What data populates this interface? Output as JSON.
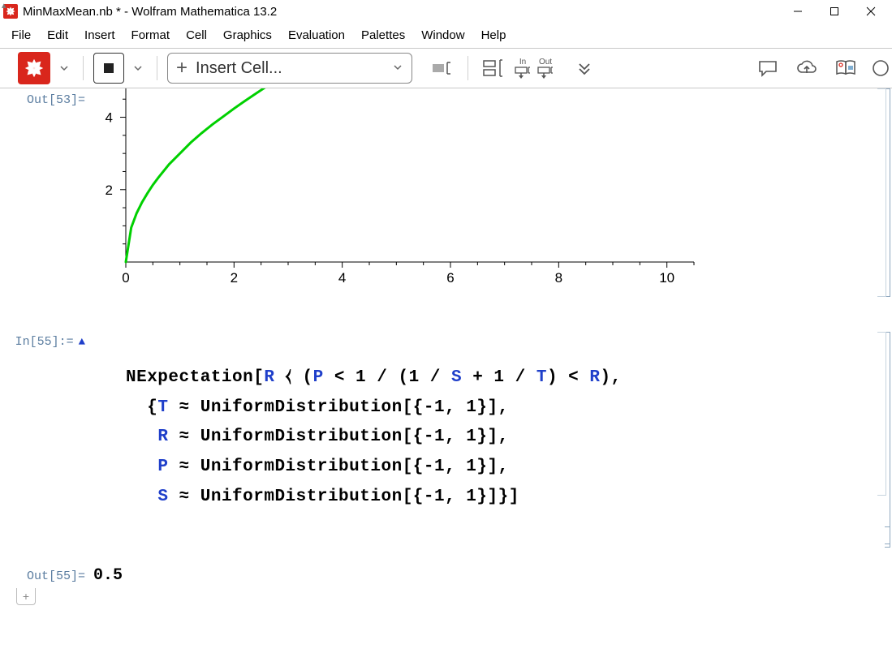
{
  "window": {
    "title": "MinMaxMean.nb * - Wolfram Mathematica 13.2"
  },
  "menus": [
    "File",
    "Edit",
    "Insert",
    "Format",
    "Cell",
    "Graphics",
    "Evaluation",
    "Palettes",
    "Window",
    "Help"
  ],
  "toolbar": {
    "insert_cell_label": "Insert Cell...",
    "in_label": "In",
    "out_label": "Out"
  },
  "cells": {
    "out53": {
      "label": "Out[53]="
    },
    "in55": {
      "label": "In[55]:="
    },
    "out55": {
      "label": "Out[55]=",
      "value": "0.5"
    }
  },
  "code55": {
    "l1_fn": "NExpectation",
    "l1_open": "[",
    "l1_v1": "R",
    "l1_cond": " ⧼ ",
    "l1_p1": "(",
    "l1_v2": "P",
    "l1_lt1": " < ",
    "l1_v3": "1",
    "l1_sl1": " / ",
    "l1_p2": "(",
    "l1_v4": "1",
    "l1_sl2": " / ",
    "l1_v5": "S",
    "l1_plus": " + ",
    "l1_v6": "1",
    "l1_sl3": " / ",
    "l1_v7": "T",
    "l1_p3": ") ",
    "l1_lt2": "< ",
    "l1_v8": "R",
    "l1_p4": ")",
    "l1_comma": ",",
    "l2_indent": "  ",
    "l2_brace": "{",
    "l2_v": "T",
    "l2_dist": " ≈ ",
    "l2_fn": "UniformDistribution",
    "l2_args": "[{-1, 1}]",
    "l2_comma": ",",
    "l3_indent": "   ",
    "l3_v": "R",
    "l3_dist": " ≈ ",
    "l3_fn": "UniformDistribution",
    "l3_args": "[{-1, 1}]",
    "l3_comma": ",",
    "l4_indent": "   ",
    "l4_v": "P",
    "l4_dist": " ≈ ",
    "l4_fn": "UniformDistribution",
    "l4_args": "[{-1, 1}]",
    "l4_comma": ",",
    "l5_indent": "   ",
    "l5_v": "S",
    "l5_dist": " ≈ ",
    "l5_fn": "UniformDistribution",
    "l5_args": "[{-1, 1}]}]"
  },
  "chart_data": {
    "type": "line",
    "title": "",
    "xlabel": "",
    "ylabel": "",
    "xlim": [
      0,
      10.5
    ],
    "ylim": [
      0,
      5.2
    ],
    "x_ticks_major": [
      0,
      2,
      4,
      6,
      8,
      10
    ],
    "y_ticks_major": [
      2,
      4
    ],
    "series": [
      {
        "name": "curve",
        "color": "#00d000",
        "x": [
          0.0,
          0.1,
          0.2,
          0.3,
          0.4,
          0.5,
          0.6,
          0.8,
          1.0,
          1.2,
          1.4,
          1.6,
          1.8,
          2.0,
          2.2,
          2.4,
          2.6,
          2.8,
          3.0
        ],
        "y": [
          0.0,
          0.95,
          1.35,
          1.65,
          1.9,
          2.13,
          2.33,
          2.7,
          3.0,
          3.3,
          3.56,
          3.8,
          4.02,
          4.24,
          4.45,
          4.65,
          4.85,
          5.02,
          5.2
        ]
      }
    ]
  }
}
